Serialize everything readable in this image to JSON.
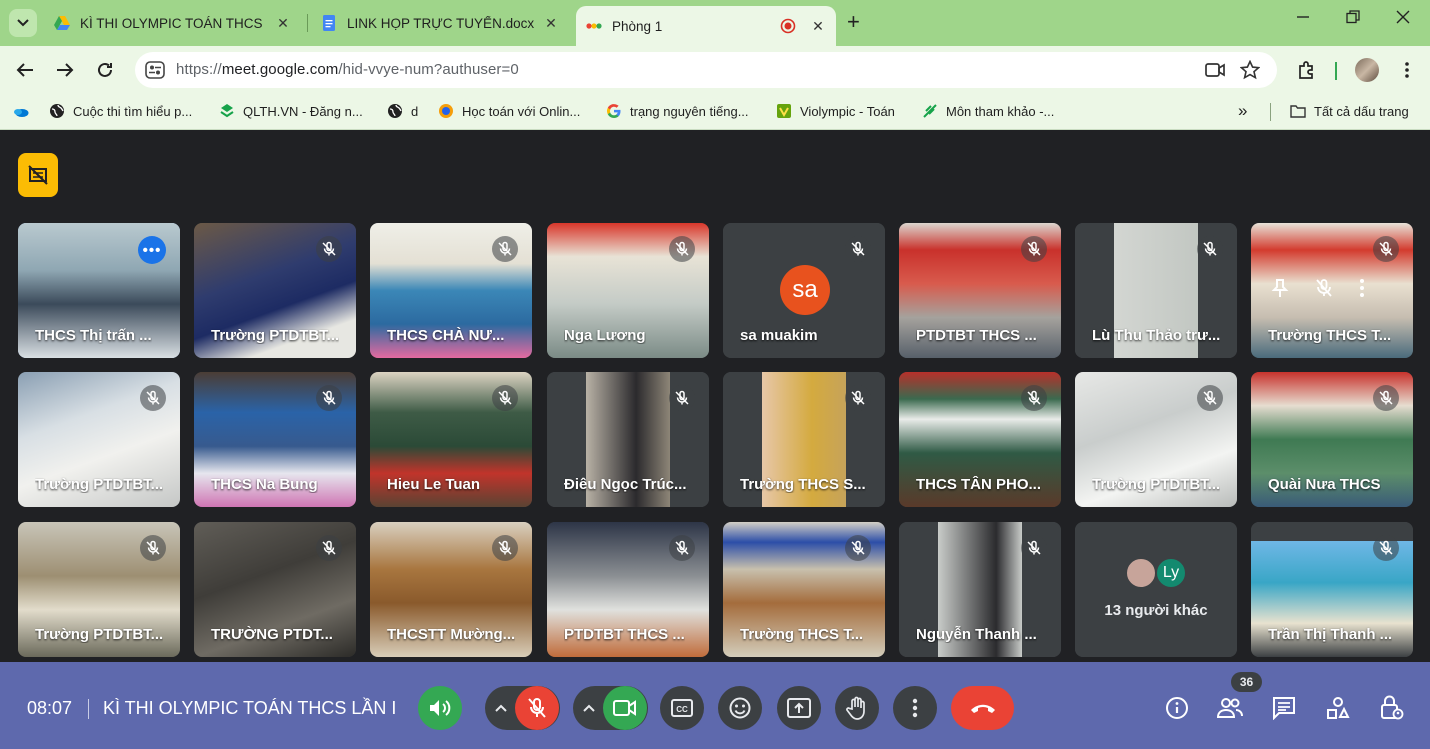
{
  "browser": {
    "tabs": [
      {
        "title": "KÌ THI OLYMPIC TOÁN THCS L",
        "icon": "google-drive-icon",
        "active": false
      },
      {
        "title": "LINK HỌP TRỰC TUYẾN.docx -",
        "icon": "google-docs-icon",
        "active": false
      },
      {
        "title": "Phòng 1",
        "icon": "meet-recording-icon",
        "active": true
      }
    ],
    "url_prefix": "https://",
    "url_host": "meet.google.com",
    "url_path": "/hid-vvye-num?authuser=0",
    "bookmarks": [
      {
        "label": "",
        "icon": "onedrive-icon"
      },
      {
        "label": "Cuộc thi tìm hiểu p...",
        "icon": "globe-icon"
      },
      {
        "label": "QLTH.VN - Đăng n...",
        "icon": "qlth-icon"
      },
      {
        "label": "d",
        "icon": "globe-icon"
      },
      {
        "label": "Học toán với Onlin...",
        "icon": "hoctoan-icon"
      },
      {
        "label": "trạng nguyên tiếng...",
        "icon": "google-g-icon"
      },
      {
        "label": "Violympic - Toán",
        "icon": "violympic-icon"
      },
      {
        "label": "Môn tham khảo -...",
        "icon": "leaf-icon"
      }
    ],
    "all_bookmarks_label": "Tất cả dấu trang",
    "bookmarks_overflow": "»"
  },
  "participants": [
    {
      "name": "THCS Thị trấn ...",
      "pinned": true,
      "scene": "classroom-blue"
    },
    {
      "name": "Trường PTDTBT...",
      "scene": "student-closeup"
    },
    {
      "name": "THCS CHÀ NƯ...",
      "scene": "meeting-room-flowers"
    },
    {
      "name": "Nga Lương",
      "scene": "classroom-board"
    },
    {
      "name": "sa muakim",
      "avatar": "sa",
      "scene": "avatar"
    },
    {
      "name": "PTDTBT THCS ...",
      "scene": "red-banner-room"
    },
    {
      "name": "Lù Thu Thảo trư...",
      "scene": "person-portrait"
    },
    {
      "name": "Trường THCS T...",
      "scene": "red-banner-room-2",
      "hover": true
    },
    {
      "name": "Trường PTDTBT...",
      "scene": "student-writing"
    },
    {
      "name": "THCS Na Bung",
      "scene": "dark-room-flowers"
    },
    {
      "name": "Hieu Le Tuan",
      "scene": "hall-stage"
    },
    {
      "name": "Điêu Ngọc Trúc...",
      "scene": "person-dark"
    },
    {
      "name": "Trường THCS S...",
      "scene": "hand-yellow"
    },
    {
      "name": "THCS TÂN PHO...",
      "scene": "projector-room"
    },
    {
      "name": "Trường PTDTBT...",
      "scene": "student-desk"
    },
    {
      "name": "Quài Nưa THCS",
      "scene": "banner-room-green"
    },
    {
      "name": "Trường PTDTBT...",
      "scene": "classroom-window"
    },
    {
      "name": "TRƯỜNG PTDT...",
      "scene": "dim-room"
    },
    {
      "name": "THCSTT Mường...",
      "scene": "exam-hall-wood"
    },
    {
      "name": "PTDTBT THCS ...",
      "scene": "students-desks"
    },
    {
      "name": "Trường THCS T...",
      "scene": "screen-meeting"
    },
    {
      "name": "Nguyễn Thanh ...",
      "scene": "person-cap"
    },
    {
      "name": "13 người khác",
      "scene": "others",
      "avatar2": "Ly"
    },
    {
      "name": "Trần Thị Thanh ...",
      "scene": "beach-woman"
    }
  ],
  "controls": {
    "time": "08:07",
    "meeting_title": "KÌ THI OLYMPIC TOÁN THCS LẦN I",
    "participant_count": "36",
    "cc_label": "CC"
  },
  "colors": {
    "tabbar": "#9fd58a",
    "toolbar": "#ecf7e6",
    "meet_bg": "#202124",
    "control_bar": "#5e69ad",
    "recording_badge": "#fbbc04",
    "end_call": "#ea4335",
    "active_green": "#34a853",
    "pinned_outline": "#8ab4f8"
  }
}
